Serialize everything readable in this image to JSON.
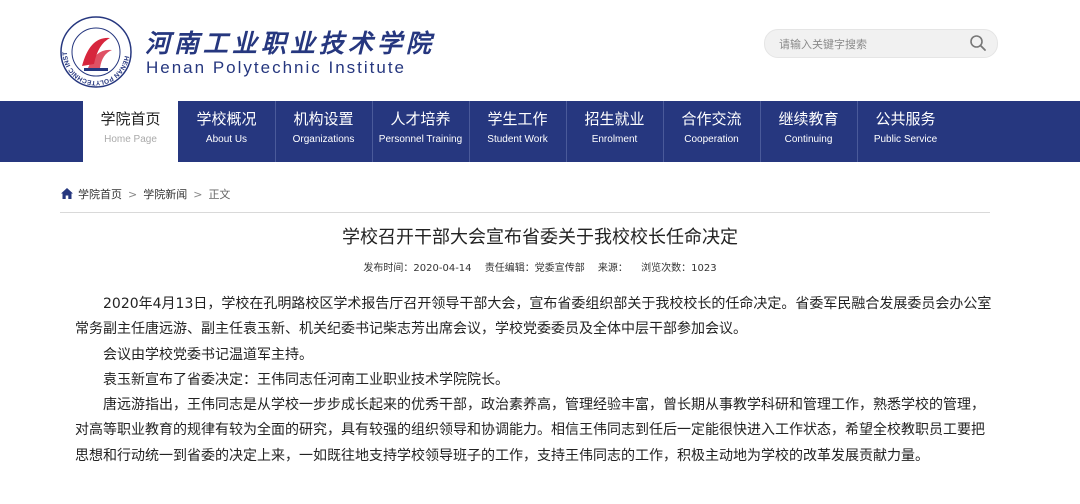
{
  "header": {
    "name_cn": "河南工业职业技术学院",
    "name_en": "Henan Polytechnic Institute",
    "logo_text": "HENAN POLYTECHNIC INSTITUTE",
    "search_placeholder": "请输入关键字搜索"
  },
  "nav": [
    {
      "zh": "学院首页",
      "en": "Home Page"
    },
    {
      "zh": "学校概况",
      "en": "About Us"
    },
    {
      "zh": "机构设置",
      "en": "Organizations"
    },
    {
      "zh": "人才培养",
      "en": "Personnel Training"
    },
    {
      "zh": "学生工作",
      "en": "Student Work"
    },
    {
      "zh": "招生就业",
      "en": "Enrolment"
    },
    {
      "zh": "合作交流",
      "en": "Cooperation"
    },
    {
      "zh": "继续教育",
      "en": "Continuing"
    },
    {
      "zh": "公共服务",
      "en": "Public Service"
    }
  ],
  "breadcrumb": {
    "home": "学院首页",
    "section": "学院新闻",
    "current": "正文",
    "separator": ">"
  },
  "article": {
    "title": "学校召开干部大会宣布省委关于我校校长任命决定",
    "meta": {
      "date": "发布时间：2020-04-14",
      "editor": "责任编辑：党委宣传部",
      "source": "来源：",
      "views": "浏览次数：1023"
    },
    "paragraphs": [
      "2020年4月13日，学校在孔明路校区学术报告厅召开领导干部大会，宣布省委组织部关于我校校长的任命决定。省委军民融合发展委员会办公室常务副主任唐远游、副主任袁玉新、机关纪委书记柴志芳出席会议，学校党委委员及全体中层干部参加会议。",
      "会议由学校党委书记温道军主持。",
      "袁玉新宣布了省委决定：王伟同志任河南工业职业技术学院院长。",
      "唐远游指出，王伟同志是从学校一步步成长起来的优秀干部，政治素养高，管理经验丰富，曾长期从事教学科研和管理工作，熟悉学校的管理，对高等职业教育的规律有较为全面的研究，具有较强的组织领导和协调能力。相信王伟同志到任后一定能很快进入工作状态，希望全校教职员工要把思想和行动统一到省委的决定上来，一如既往地支持学校领导班子的工作，支持王伟同志的工作，积极主动地为学校的改革发展贡献力量。"
    ]
  },
  "colors": {
    "brand_blue": "#26377f",
    "logo_red": "#d7263d"
  },
  "icons": {
    "search": "magnifier",
    "home": "house",
    "logo": "emblem"
  }
}
